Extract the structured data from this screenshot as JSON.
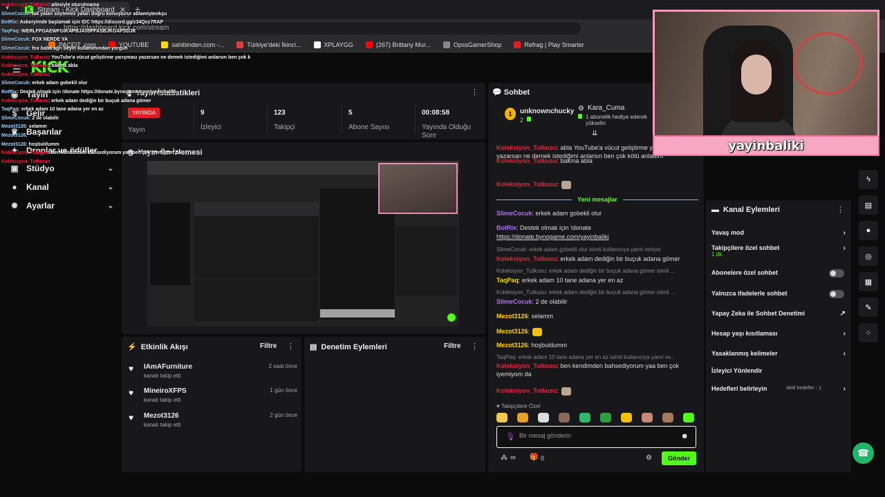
{
  "browser": {
    "tab_title": "Stream - Kick Dashboard",
    "url": "https://dashboard.kick.com/stream",
    "bookmarks": [
      {
        "label": "PACEIT .com",
        "color": "#ff6a00"
      },
      {
        "label": "YOUTUBE",
        "color": "#ff0000"
      },
      {
        "label": "sahibinden.com -...",
        "color": "#ffd800"
      },
      {
        "label": "Türkiye'deki İkinci...",
        "color": "#e03a3a"
      },
      {
        "label": "XPLAYGG",
        "color": "#ffffff"
      },
      {
        "label": "(267) Brittany Mur...",
        "color": "#ff0000"
      },
      {
        "label": "OpssGamerShop",
        "color": "#888888"
      },
      {
        "label": "Refrag | Play Smarter",
        "color": "#e01d23"
      }
    ]
  },
  "brand": {
    "logo": "KICK",
    "accent": "#53fc18"
  },
  "sidebar": {
    "items": [
      {
        "label": "Yayın",
        "icon": "broadcast-icon"
      },
      {
        "label": "Gelir",
        "icon": "dollar-icon"
      },
      {
        "label": "Başarılar",
        "icon": "trophy-icon"
      },
      {
        "label": "Droplar ve ödüller",
        "icon": "gift-icon"
      },
      {
        "label": "Stüdyo",
        "icon": "studio-icon"
      },
      {
        "label": "Kanal",
        "icon": "user-icon"
      },
      {
        "label": "Ayarlar",
        "icon": "gear-icon"
      }
    ]
  },
  "stats": {
    "title": "Yayın İstatistikleri",
    "live_badge": "YAYINDA",
    "status_label": "Yayın",
    "viewers": {
      "value": "9",
      "label": "İzleyici"
    },
    "followers": {
      "value": "123",
      "label": "Takipçi"
    },
    "subs": {
      "value": "5",
      "label": "Abone Sayısı"
    },
    "uptime": {
      "value": "00:08:58",
      "label": "Yayında Olduğu Süre"
    }
  },
  "preview": {
    "title": "Yayın Ön İzlemesi"
  },
  "activity": {
    "title": "Etkinlik Akışı",
    "filter": "Filtre",
    "items": [
      {
        "name": "IAmAFurniture",
        "sub": "kanalı takip etti",
        "time": "2 saat önce"
      },
      {
        "name": "MineiroXFPS",
        "sub": "kanalı takip etti",
        "time": "1 gün önce"
      },
      {
        "name": "Mezot3126",
        "sub": "kanalı takip etti",
        "time": "2 gün önce"
      }
    ]
  },
  "moderation": {
    "title": "Denetim Eylemleri",
    "filter": "Filtre"
  },
  "chat": {
    "title": "Sohbet",
    "pinned_user": "unknownchucky",
    "pinned_count": "2",
    "gifter": "Kara_Cuma",
    "gifter_text": "1 abonelik hediye ederek yükselin",
    "new_messages": "Yeni mesajlar",
    "messages": [
      {
        "user": "Koleksiyon_Tutkusu",
        "text": ": abla YouTube'a vücut geliştirme yarışması yazarsan ne demek istediğimi anlarsın ben çok kötü anlattım"
      },
      {
        "user": "Koleksiyon_Tutkusu",
        "text": ": bakma abla"
      },
      {
        "user": "Koleksiyon_Tutkusu",
        "text": ":"
      },
      {
        "user": "SlimeCocuk",
        "text": ": erkek adam gobekli olur"
      },
      {
        "user": "BotRix",
        "text": ": Destek olmak için !donate"
      },
      {
        "user": "",
        "text": "https://donate.bynogame.com/yayinbaliki"
      },
      {
        "user": "",
        "text": "SlimeCocuk: erkek adam gobekli olur isimli kullanıcıya yanıt veriyor"
      },
      {
        "user": "Koleksiyon_Tutkusu",
        "text": ": erkek adam dediğin bir buçuk adana gömer"
      },
      {
        "user": "",
        "text": "Koleksiyon_Tutkusu: erkek adam dediğin bir buçuk adana gömer isimli ..."
      },
      {
        "user": "TaqPaq",
        "text": ": erkek adam 10 tane adana yer en az"
      },
      {
        "user": "",
        "text": "Koleksiyon_Tutkusu: erkek adam dediğin bir buçuk adana gömer isimli ..."
      },
      {
        "user": "SlimeCocuk",
        "text": ": 2 de olabilir"
      },
      {
        "user": "Mezot3126",
        "text": ": selamm"
      },
      {
        "user": "Mezot3126",
        "text": ":"
      },
      {
        "user": "Mezot3126",
        "text": ": hoşbuldumm"
      },
      {
        "user": "",
        "text": "TaqPaq: erkek adam 10 tane adana yer en az isimli kullanıcıya yanıt ve..."
      },
      {
        "user": "Koleksiyon_Tutkusu",
        "text": ": ben kendimden bahsediyorum yaa ben çok iyemiyom da"
      },
      {
        "user": "Koleksiyon_Tutkusu",
        "text": ":"
      }
    ],
    "followers_only": "Takipçilere Özel",
    "input_placeholder": "Bir mesaj gönderin",
    "points": "∞",
    "gift_count": "0",
    "send": "Gönder"
  },
  "channel_actions": {
    "title": "Kanal Eylemleri",
    "items": [
      {
        "label": "Yavaş mod",
        "control": "arrow"
      },
      {
        "label": "Takipçilere özel sohbet",
        "sub": "1 dk.",
        "control": "arrow"
      },
      {
        "label": "Abonelere özel sohbet",
        "control": "toggle"
      },
      {
        "label": "Yalnızca ifadelerle sohbet",
        "control": "toggle"
      },
      {
        "label": "Yapay Zeka ile Sohbet Denetimi",
        "control": "external"
      },
      {
        "label": "Hesap yaşı kısıtlaması",
        "control": "arrow"
      },
      {
        "label": "Yasaklanmış kelimeler",
        "control": "arrow"
      },
      {
        "label": "İzleyici Yönlendir",
        "control": "none"
      },
      {
        "label": "Hedefleri belirleyin",
        "badge": "Aktif hedefler - 1",
        "control": "arrow"
      }
    ]
  },
  "webcam": {
    "name": "yayinbaliki"
  },
  "overlay_chat": [
    {
      "user": "Koleksiyon_Tutkusu",
      "text": ": ailesiyle oturulmama"
    },
    {
      "user": "SlimeCocuk",
      "text": ": tak yalan söylemez yaları doğru konuşturur ablamişteokşu"
    },
    {
      "user": "BotRix",
      "text": ": Askeryimde başlamak için IDC https://discord.gg/z34Qcc7RAP"
    },
    {
      "user": "TaqPaq",
      "text": ": WERLFPGAEWFGIKAPBJA55PFASBJKGAPSDJK"
    },
    {
      "user": "SlimeCocuk",
      "text": ": FOX NERDE YA"
    },
    {
      "user": "SlimeCocuk",
      "text": ": fox baba ağrı beyin kullanımından yorgun"
    },
    {
      "user": "Koleksiyon_Tutkusu",
      "text": ": YouTube'a vücut geliştirme yarışması yazarsan ne demek istediğimi anlarsın ben çok kötü anlattım"
    },
    {
      "user": "Koleksiyon_Tutkusu",
      "text": ": bakma abla"
    },
    {
      "user": "Koleksiyon_Tutkusu",
      "text": ":"
    },
    {
      "user": "SlimeCocuk",
      "text": ": erkek adam gobekli olur"
    },
    {
      "user": "BotRix",
      "text": ": Destek olmak için !donate https://donate.bynogame.com/yayinbaliki"
    },
    {
      "user": "Koleksiyon_Tutkusu",
      "text": ": erkek adam dediğin bir buçuk adana gömer"
    },
    {
      "user": "TaqPaq",
      "text": ": erkek adam 10 tane adana yer en az"
    },
    {
      "user": "SlimeCocuk",
      "text": ": 2 de olabilir"
    },
    {
      "user": "Mezot3126",
      "text": ": selamm"
    },
    {
      "user": "Mezot3126",
      "text": ":"
    },
    {
      "user": "Mezot3126",
      "text": ": hoşbuldumm"
    },
    {
      "user": "Koleksiyon_Tutkusu",
      "text": ": ben kendimden bahsediyorum yaa ben çok iyemiyom da"
    },
    {
      "user": "Koleksiyon_Tutkusu",
      "text": ":"
    }
  ],
  "colors": {
    "panel": "#18181a",
    "page": "#0b0b0c",
    "live": "#e01d23",
    "user_red": "#e8233e",
    "user_purple": "#b070ff",
    "user_yellow": "#ffd400",
    "user_cyan": "#5fd1ff",
    "user_green": "#53fc18"
  }
}
